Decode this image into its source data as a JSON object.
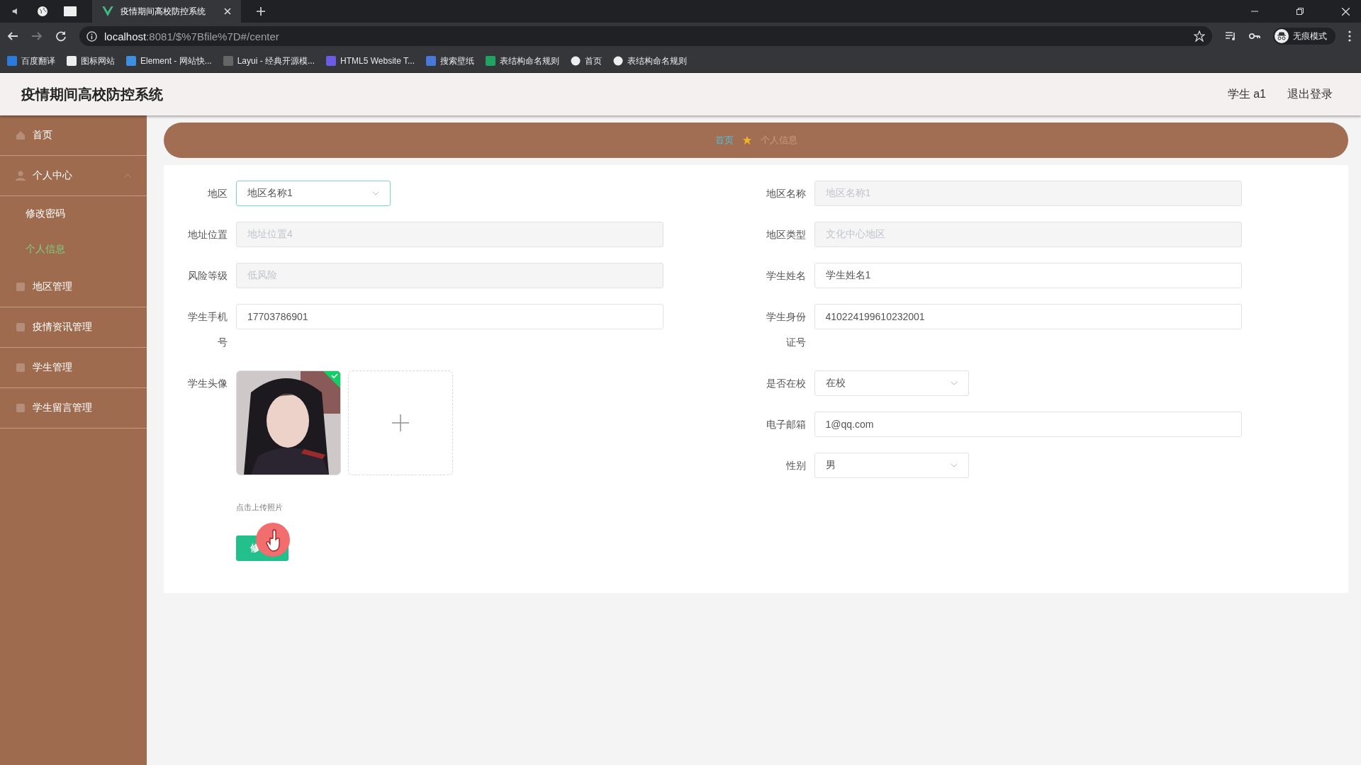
{
  "browser": {
    "tabs": [
      {
        "title": "疫情期间高校防控系统",
        "selected": true
      }
    ],
    "url": {
      "host": "localhost",
      "rest": ":8081/$%7Bfile%7D#/center"
    },
    "bookmarks": [
      {
        "label": "百度翻译"
      },
      {
        "label": "图标网站"
      },
      {
        "label": "Element - 网站快..."
      },
      {
        "label": "Layui - 经典开源模..."
      },
      {
        "label": "HTML5 Website T..."
      },
      {
        "label": "搜索壁纸"
      },
      {
        "label": "表结构命名规则"
      },
      {
        "label": "首页"
      },
      {
        "label": "表结构命名规则"
      }
    ],
    "profile": "无痕模式"
  },
  "header": {
    "title": "疫情期间高校防控系统",
    "user": "学生 a1",
    "logout": "退出登录"
  },
  "sidebar": {
    "items": [
      {
        "label": "首页",
        "selected": false
      },
      {
        "label": "个人中心",
        "selected": false,
        "expanded": true,
        "children": [
          {
            "label": "修改密码",
            "selected": false
          },
          {
            "label": "个人信息",
            "selected": true
          }
        ]
      },
      {
        "label": "地区管理",
        "selected": false
      },
      {
        "label": "疫情资讯管理",
        "selected": false
      },
      {
        "label": "学生管理",
        "selected": false
      },
      {
        "label": "学生留言管理",
        "selected": false
      }
    ]
  },
  "breadcrumb": [
    {
      "label": "首页",
      "current": false
    },
    {
      "label": "个人信息",
      "current": true
    }
  ],
  "form": {
    "left": [
      {
        "label": "地区",
        "kind": "select",
        "value": "地区名称1",
        "disabled": false,
        "focused": true
      },
      {
        "label": "地址位置",
        "kind": "input",
        "value": "地址位置4",
        "disabled": true
      },
      {
        "label": "风险等级",
        "kind": "input",
        "value": "低风险",
        "disabled": true
      },
      {
        "label": "学生手机号",
        "kind": "input",
        "value": "17703786901",
        "disabled": false
      },
      {
        "label": "学生头像",
        "kind": "upload",
        "images": [
          {
            "kind": "picture",
            "uploaded": true
          }
        ],
        "hint": "点击上传照片"
      }
    ],
    "right": [
      {
        "label": "地区名称",
        "kind": "input",
        "value": "地区名称1",
        "disabled": true
      },
      {
        "label": "地区类型",
        "kind": "input",
        "value": "文化中心地区",
        "disabled": true
      },
      {
        "label": "学生姓名",
        "kind": "input",
        "value": "学生姓名1",
        "disabled": false
      },
      {
        "label": "学生身份证号",
        "kind": "input",
        "value": "410224199610232001",
        "disabled": false
      },
      {
        "label": "是否在校",
        "kind": "select",
        "value": "在校",
        "disabled": false
      },
      {
        "label": "电子邮箱",
        "kind": "input",
        "value": "1@qq.com",
        "disabled": false
      },
      {
        "label": "性别",
        "kind": "select",
        "value": "男",
        "disabled": false
      }
    ],
    "submit": "修"
  }
}
